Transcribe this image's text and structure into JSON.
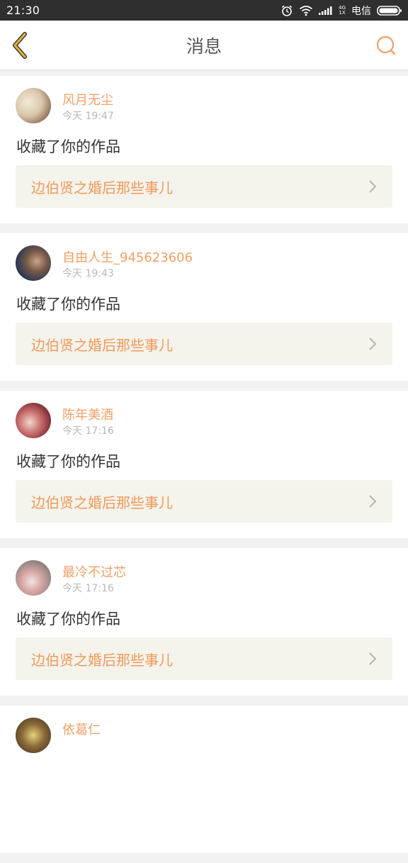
{
  "status_bar": {
    "time": "21:30",
    "network_top": "4G",
    "network_bottom": "1X",
    "carrier": "电信",
    "icons": [
      "alarm-icon",
      "wifi-icon",
      "signal-icon",
      "battery-icon"
    ]
  },
  "header": {
    "title": "消息",
    "back_icon": "chevron-left-icon",
    "search_icon": "search-icon",
    "accent_color": "#e8b13c"
  },
  "messages": [
    {
      "username": "风月无尘",
      "time": "今天 19:47",
      "action": "收藏了你的作品",
      "work_title": "边伯贤之婚后那些事儿"
    },
    {
      "username": "自由人生_945623606",
      "time": "今天 19:43",
      "action": "收藏了你的作品",
      "work_title": "边伯贤之婚后那些事儿"
    },
    {
      "username": "陈年美酒",
      "time": "今天 17:16",
      "action": "收藏了你的作品",
      "work_title": "边伯贤之婚后那些事儿"
    },
    {
      "username": "最冷不过芯",
      "time": "今天 17:16",
      "action": "收藏了你的作品",
      "work_title": "边伯贤之婚后那些事儿"
    },
    {
      "username": "依葛仁",
      "time": "",
      "action": "",
      "work_title": ""
    }
  ],
  "colors": {
    "username": "#f0a067",
    "work_title": "#ef9a5b",
    "link_background": "#f4f3ec",
    "page_background": "#f2f2f2"
  }
}
